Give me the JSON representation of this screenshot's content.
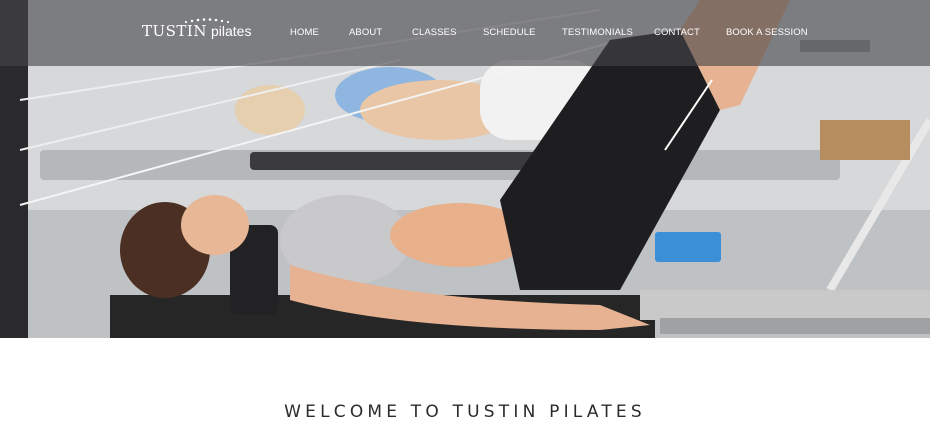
{
  "brand": {
    "name_main": "TUSTIN",
    "name_sub": "pilates"
  },
  "nav": {
    "items": [
      {
        "label": "HOME"
      },
      {
        "label": "ABOUT"
      },
      {
        "label": "CLASSES"
      },
      {
        "label": "SCHEDULE"
      },
      {
        "label": "TESTIMONIALS"
      },
      {
        "label": "CONTACT"
      },
      {
        "label": "BOOK A SESSION"
      }
    ]
  },
  "welcome": {
    "title": "WELCOME TO TUSTIN PILATES"
  },
  "colors": {
    "header_overlay": "#464648",
    "text_light": "#ffffff",
    "text_dark": "#2b2b2b"
  }
}
